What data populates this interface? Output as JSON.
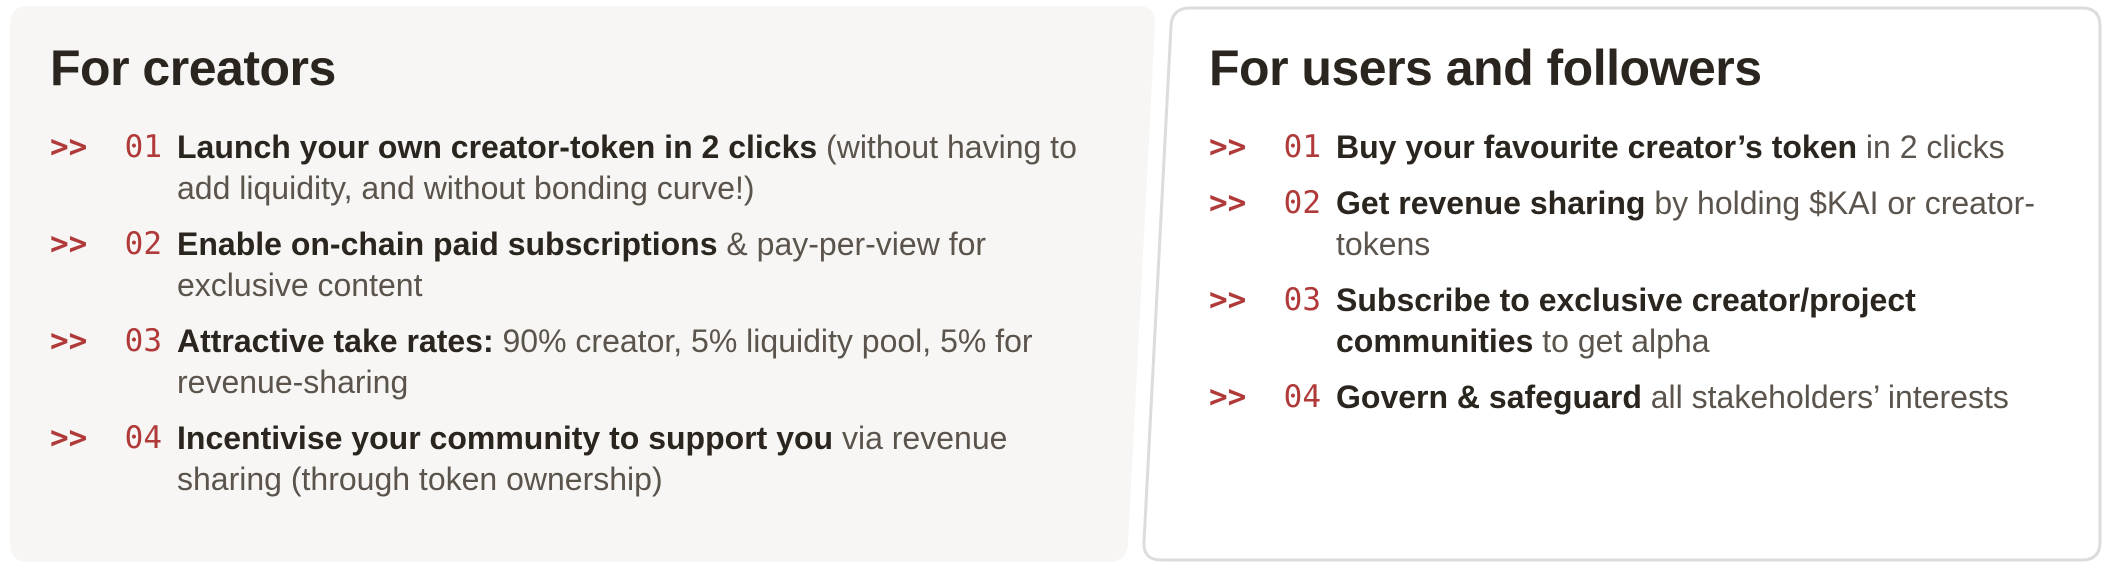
{
  "colors": {
    "left_panel_bg": "#f7f6f4",
    "right_panel_border": "#dcdcdc",
    "accent": "#b03a3a",
    "heading": "#2b251f",
    "body_text": "#5b544c"
  },
  "creators": {
    "title": "For creators",
    "items": [
      {
        "marker": ">>",
        "number": "01",
        "strong": "Launch your own creator-token in 2 clicks",
        "rest": " (without having to add liquidity, and without bonding curve!)"
      },
      {
        "marker": ">>",
        "number": "02",
        "strong": "Enable on-chain paid subscriptions",
        "rest": " & pay-per-view for exclusive content"
      },
      {
        "marker": ">>",
        "number": "03",
        "strong": "Attractive take rates:",
        "rest": " 90% creator, 5% liquidity pool, 5% for revenue-sharing"
      },
      {
        "marker": ">>",
        "number": "04",
        "strong": "Incentivise your community to support you",
        "rest": " via revenue sharing (through token ownership)"
      }
    ]
  },
  "users": {
    "title": "For users and followers",
    "items": [
      {
        "marker": ">>",
        "number": "01",
        "strong": "Buy your favourite creator’s token",
        "rest": " in 2 clicks"
      },
      {
        "marker": ">>",
        "number": "02",
        "strong": "Get revenue sharing",
        "rest": " by holding $KAI or creator-tokens"
      },
      {
        "marker": ">>",
        "number": "03",
        "strong": "Subscribe to exclusive creator/project communities",
        "rest": " to get alpha"
      },
      {
        "marker": ">>",
        "number": "04",
        "strong": "Govern & safeguard",
        "rest": " all stakeholders’ interests"
      }
    ]
  }
}
